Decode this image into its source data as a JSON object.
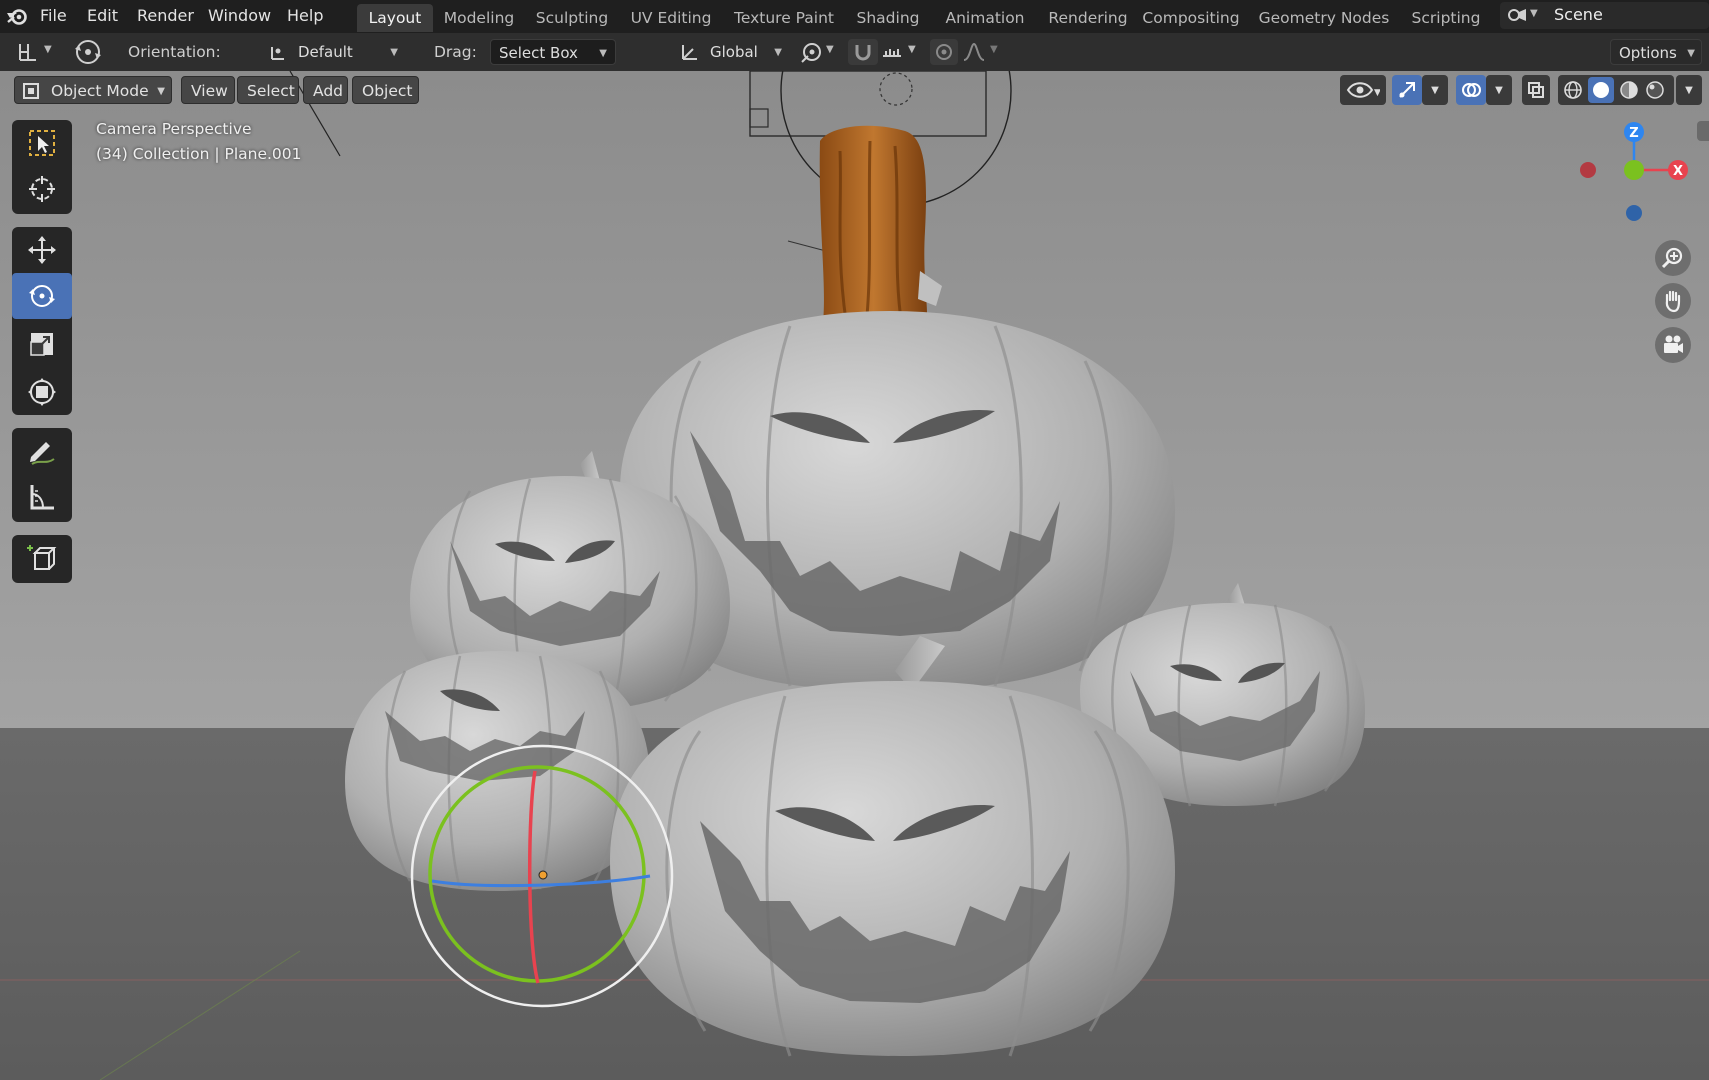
{
  "menubar": {
    "items": [
      "File",
      "Edit",
      "Render",
      "Window",
      "Help"
    ]
  },
  "workspaces": {
    "tabs": [
      "Layout",
      "Modeling",
      "Sculpting",
      "UV Editing",
      "Texture Paint",
      "Shading",
      "Animation",
      "Rendering",
      "Compositing",
      "Geometry Nodes",
      "Scripting"
    ],
    "active": "Layout"
  },
  "scene": {
    "name": "Scene"
  },
  "tool_header": {
    "orientation_label": "Orientation:",
    "orientation_value": "Default",
    "drag_label": "Drag:",
    "drag_value": "Select Box",
    "transform_space": "Global",
    "options_label": "Options"
  },
  "viewport_header": {
    "mode": "Object Mode",
    "menus": [
      "View",
      "Select",
      "Add",
      "Object"
    ]
  },
  "overlay": {
    "view_name": "Camera Perspective",
    "collection_info": "(34) Collection | Plane.001"
  },
  "gizmo": {
    "x_label": "X",
    "y_label": "",
    "z_label": "Z"
  },
  "colors": {
    "accent": "#4a72b6",
    "axis_x": "#e8434f",
    "axis_y": "#7bc11f",
    "axis_z": "#2e86f0",
    "pumpkin": "#b4b4b4",
    "stem": "#a15a1c"
  },
  "icons": {
    "blender_logo": "blender-logo-icon",
    "select_box": "select-box-icon",
    "cursor": "cursor-icon",
    "move": "move-icon",
    "rotate": "rotate-icon",
    "scale": "scale-icon",
    "transform": "transform-icon",
    "annotate": "annotate-icon",
    "measure": "measure-icon",
    "add_cube": "add-cube-icon",
    "zoom": "zoom-icon",
    "pan": "hand-icon",
    "camera": "camera-view-icon"
  }
}
